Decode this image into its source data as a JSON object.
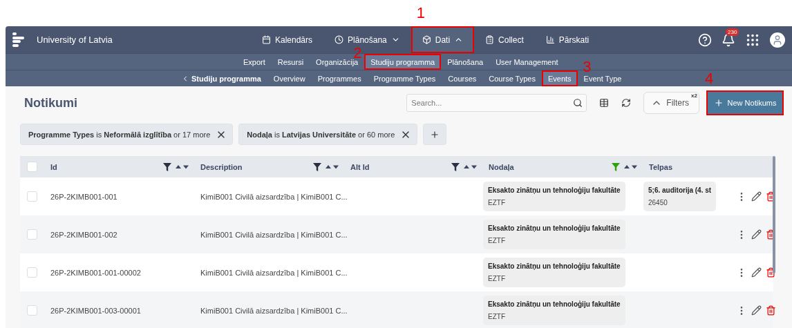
{
  "brand": {
    "title": "University of Latvia"
  },
  "top_nav": [
    {
      "label": "Kalendārs",
      "dropdown": false,
      "selected": false
    },
    {
      "label": "Plānošana",
      "dropdown": true,
      "expanded": false,
      "selected": false
    },
    {
      "label": "Dati",
      "dropdown": true,
      "expanded": true,
      "selected": true,
      "callout": {
        "number": "1"
      }
    },
    {
      "label": "Collect",
      "dropdown": false,
      "selected": false
    },
    {
      "label": "Pārskati",
      "dropdown": false,
      "selected": false
    }
  ],
  "notifications": {
    "count": "230"
  },
  "sub_nav": [
    {
      "label": "Export",
      "selected": false
    },
    {
      "label": "Resursi",
      "selected": false
    },
    {
      "label": "Organizācija",
      "selected": false
    },
    {
      "label": "Studiju programma",
      "selected": true,
      "callout": {
        "number": "2"
      }
    },
    {
      "label": "Plānošana",
      "selected": false
    },
    {
      "label": "User Management",
      "selected": false
    }
  ],
  "section_nav": {
    "back": "Studiju programma",
    "items": [
      {
        "label": "Overview",
        "selected": false
      },
      {
        "label": "Programmes",
        "selected": false
      },
      {
        "label": "Programme Types",
        "selected": false
      },
      {
        "label": "Courses",
        "selected": false
      },
      {
        "label": "Course Types",
        "selected": false
      },
      {
        "label": "Events",
        "selected": true,
        "callout": {
          "number": "3"
        }
      },
      {
        "label": "Event Type",
        "selected": false
      }
    ]
  },
  "page": {
    "title": "Notikumi",
    "search": {
      "placeholder": "Search..."
    },
    "filters_button": {
      "label": "Filters",
      "badge": "x2",
      "expanded": true
    },
    "new_button": {
      "label": "New Notikums",
      "callout": {
        "number": "4"
      }
    }
  },
  "active_filters": [
    "**Programme Types** is **Neformālā izglītība** or 17 more",
    "**Nodaļa** is **Latvijas Universitāte** or 60 more"
  ],
  "table": {
    "all_selected": false,
    "columns": [
      {
        "label": "Id",
        "controls": true,
        "filter_active": false
      },
      {
        "label": "Description",
        "controls": true,
        "filter_active": false
      },
      {
        "label": "Alt Id",
        "controls": true,
        "filter_active": false
      },
      {
        "label": "Nodaļa",
        "controls": true,
        "filter_active": true
      },
      {
        "label": "Telpas",
        "controls": false
      }
    ],
    "rows": [
      {
        "checked": false,
        "id": "26P-2KIMB001-001",
        "description": "KimiB001 Civilā aizsardzība | KimiB001 C...",
        "nodala": {
          "name": "Eksakto zinātņu un tehnoloģiju fakultāte",
          "code": "EZTF"
        },
        "telpas": {
          "name": "5;6. auditorija (4. st",
          "code": "26450"
        }
      },
      {
        "checked": false,
        "id": "26P-2KIMB001-002",
        "description": "KimiB001 Civilā aizsardzība | KimiB001 C...",
        "nodala": {
          "name": "Eksakto zinātņu un tehnoloģiju fakultāte",
          "code": "EZTF"
        }
      },
      {
        "checked": false,
        "id": "26P-2KIMB001-001-00002",
        "description": "KimiB001 Civilā aizsardzība | KimiB001 C...",
        "nodala": {
          "name": "Eksakto zinātņu un tehnoloģiju fakultāte",
          "code": "EZTF"
        }
      },
      {
        "checked": false,
        "id": "26P-2KIMB001-003-00001",
        "description": "KimiB001 Civilā aizsardzība | KimiB001 C...",
        "nodala": {
          "name": "Eksakto zinātņu un tehnoloģiju fakultāte",
          "code": "EZTF"
        }
      }
    ]
  }
}
